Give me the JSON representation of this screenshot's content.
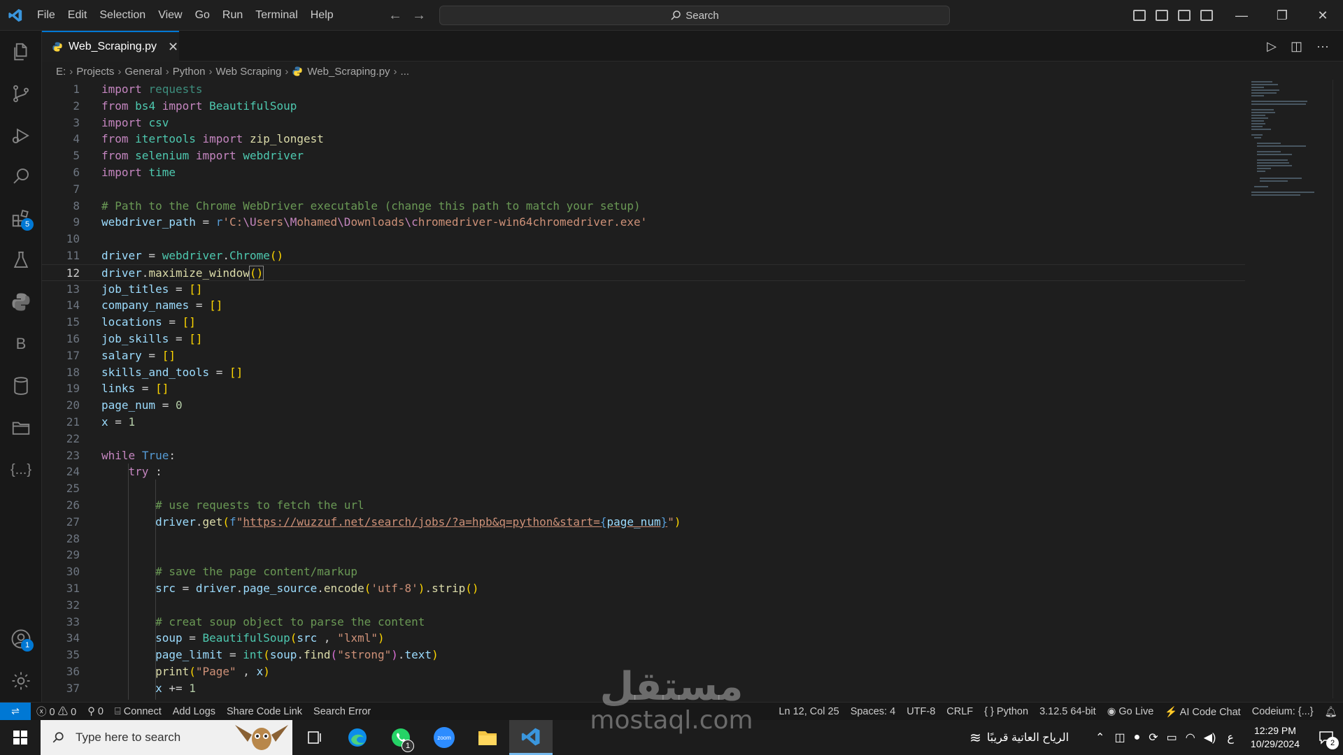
{
  "titlebar": {
    "menu": [
      "File",
      "Edit",
      "Selection",
      "View",
      "Go",
      "Run",
      "Terminal",
      "Help"
    ],
    "search_label": "Search"
  },
  "activity": {
    "extensions_badge": "5",
    "accounts_badge": "1",
    "b_label": "B",
    "json_label": "{...}"
  },
  "tab": {
    "filename": "Web_Scraping.py",
    "close": "✕"
  },
  "breadcrumb": [
    "E:",
    "Projects",
    "General",
    "Python",
    "Web Scraping",
    "Web_Scraping.py",
    "..."
  ],
  "editor": {
    "line_numbers": [
      "1",
      "2",
      "3",
      "4",
      "5",
      "6",
      "7",
      "8",
      "9",
      "10",
      "11",
      "12",
      "13",
      "14",
      "15",
      "16",
      "17",
      "18",
      "19",
      "20",
      "21",
      "22",
      "23",
      "24",
      "25",
      "26",
      "27",
      "28",
      "29",
      "30",
      "31",
      "32",
      "33",
      "34",
      "35",
      "36",
      "37"
    ],
    "current_line": "12"
  },
  "statusbar": {
    "errors": "0",
    "warnings": "0",
    "ports": "0",
    "connect": "Connect",
    "add_logs": "Add Logs",
    "share_code_link": "Share Code Link",
    "search_error": "Search Error",
    "position": "Ln 12, Col 25",
    "spaces": "Spaces: 4",
    "encoding": "UTF-8",
    "eol": "CRLF",
    "language": "Python",
    "interpreter": "3.12.5 64-bit",
    "go_live": "Go Live",
    "ai_chat": "AI Code Chat",
    "codeium": "Codeium: {...}"
  },
  "taskbar": {
    "search_placeholder": "Type here to search",
    "whatsapp_badge": "1",
    "zoom_label": "zoom",
    "weather": "الرياح العاتية قريبًا",
    "lang": "ع",
    "time": "12:29 PM",
    "date": "10/29/2024",
    "notif_badge": "2"
  },
  "watermark": {
    "arabic": "مستقل",
    "latin": "mostaql.com"
  },
  "colors": {
    "accent": "#0078d4",
    "editor_bg": "#1e1e1e",
    "keyword": "#c586c0",
    "string": "#ce9178",
    "comment": "#6a9955"
  }
}
